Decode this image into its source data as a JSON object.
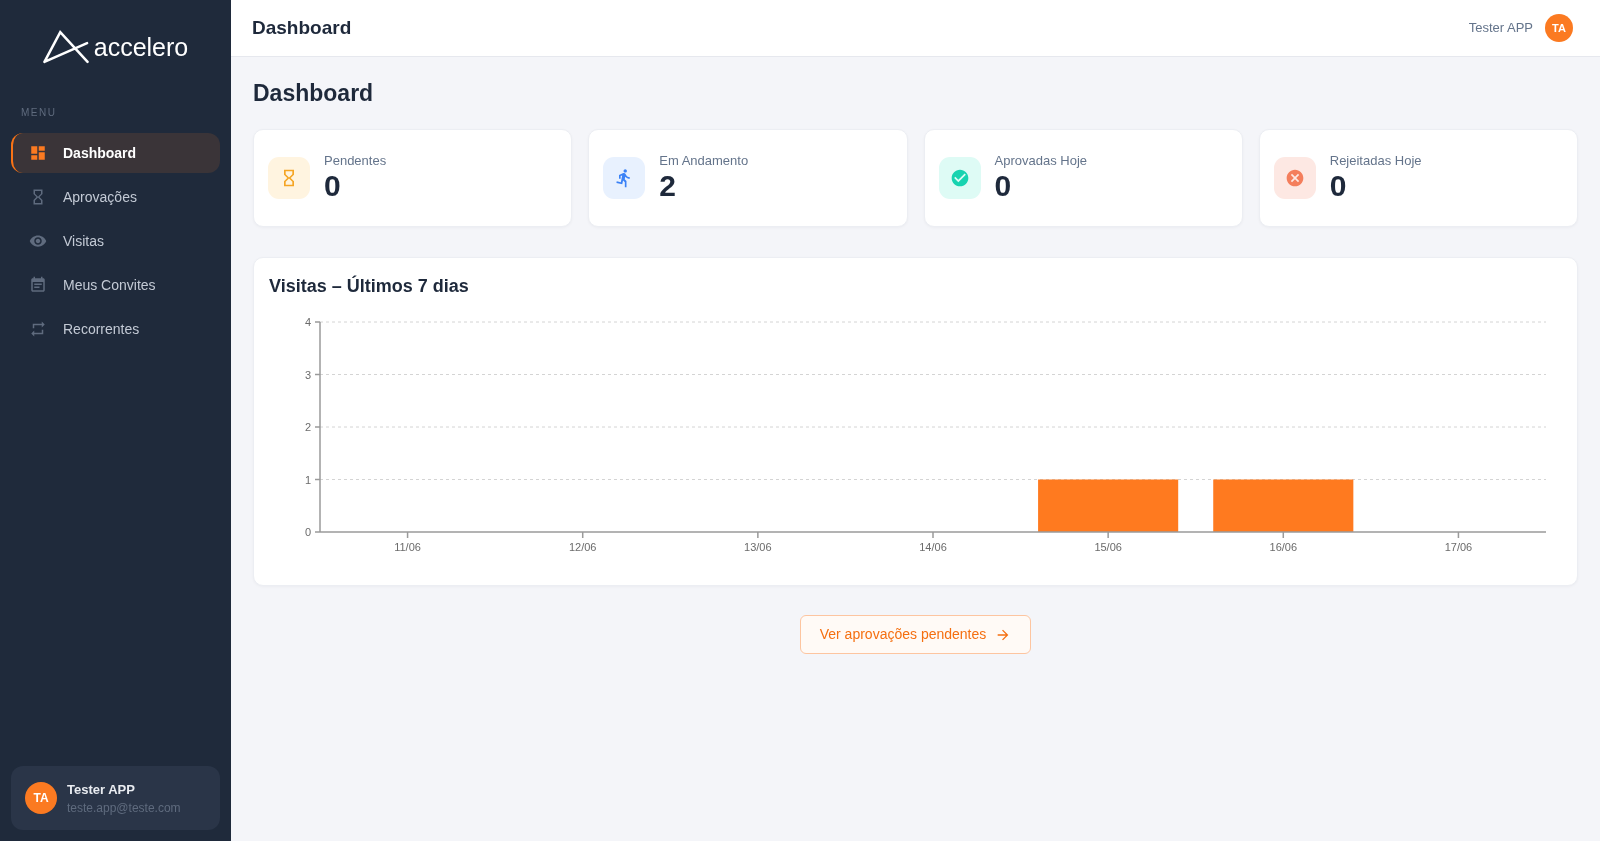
{
  "sidebar": {
    "logo": "accelero",
    "section_label": "MENU",
    "items": [
      {
        "label": "Dashboard",
        "selected": true
      },
      {
        "label": "Aprovações",
        "selected": false
      },
      {
        "label": "Visitas",
        "selected": false
      },
      {
        "label": "Meus Convites",
        "selected": false
      },
      {
        "label": "Recorrentes",
        "selected": false
      }
    ],
    "user": {
      "initials": "TA",
      "name": "Tester APP",
      "email": "teste.app@teste.com"
    }
  },
  "header": {
    "title": "Dashboard",
    "user_name": "Tester APP",
    "initials": "TA"
  },
  "page_title": "Dashboard",
  "stats": [
    {
      "kind": "pending",
      "label": "Pendentes",
      "value": "0"
    },
    {
      "kind": "progress",
      "label": "Em Andamento",
      "value": "2"
    },
    {
      "kind": "approved",
      "label": "Aprovadas Hoje",
      "value": "0"
    },
    {
      "kind": "rejected",
      "label": "Rejeitadas Hoje",
      "value": "0"
    }
  ],
  "visits_panel": {
    "chart_data": {
      "type": "bar",
      "title": "Visitas – Últimos 7 dias",
      "categories": [
        "11/06",
        "12/06",
        "13/06",
        "14/06",
        "15/06",
        "16/06",
        "17/06"
      ],
      "values": [
        0,
        0,
        0,
        0,
        1,
        1,
        0
      ],
      "ylim": [
        0,
        4
      ],
      "yticks": [
        0,
        1,
        2,
        3,
        4
      ],
      "grid": true
    }
  },
  "action_button": "Ver aprovações pendentes"
}
